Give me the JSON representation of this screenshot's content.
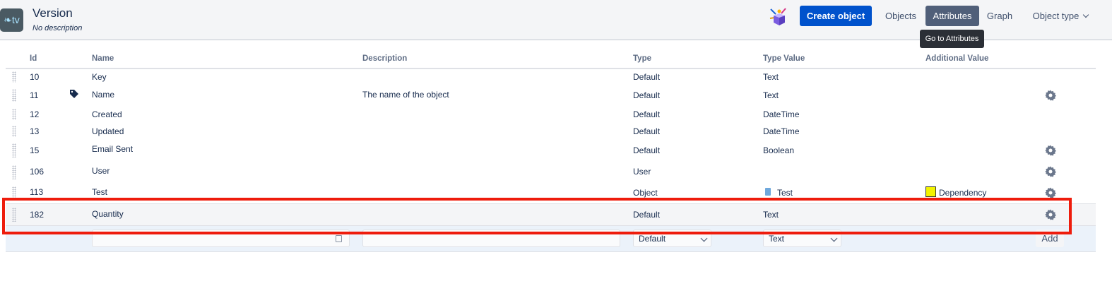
{
  "header": {
    "app_logo_text": "❧tv",
    "title": "Version",
    "subtitle": "No description",
    "create_button": "Create object",
    "nav": {
      "objects": "Objects",
      "attributes": "Attributes",
      "graph": "Graph",
      "object_type": "Object type"
    },
    "tooltip": "Go to Attributes"
  },
  "table": {
    "columns": [
      "Id",
      "Name",
      "Description",
      "Type",
      "Type Value",
      "Additional Value"
    ],
    "rows": [
      {
        "id": "10",
        "name": "Key",
        "description": "",
        "type": "Default",
        "type_value": "Text",
        "additional": "",
        "label_icon": false,
        "settings": false
      },
      {
        "id": "11",
        "name": "Name",
        "description": "The name of the object",
        "type": "Default",
        "type_value": "Text",
        "additional": "",
        "label_icon": true,
        "settings": true
      },
      {
        "id": "12",
        "name": "Created",
        "description": "",
        "type": "Default",
        "type_value": "DateTime",
        "additional": "",
        "label_icon": false,
        "settings": false
      },
      {
        "id": "13",
        "name": "Updated",
        "description": "",
        "type": "Default",
        "type_value": "DateTime",
        "additional": "",
        "label_icon": false,
        "settings": false
      },
      {
        "id": "15",
        "name": "Email Sent",
        "description": "",
        "type": "Default",
        "type_value": "Boolean",
        "additional": "",
        "label_icon": false,
        "settings": true
      },
      {
        "id": "106",
        "name": "User",
        "description": "",
        "type": "User",
        "type_value": "",
        "additional": "",
        "label_icon": false,
        "settings": true
      },
      {
        "id": "113",
        "name": "Test",
        "description": "",
        "type": "Object",
        "type_value": "Test",
        "additional": "Dependency",
        "label_icon": false,
        "settings": true
      },
      {
        "id": "182",
        "name": "Quantity",
        "description": "",
        "type": "Default",
        "type_value": "Text",
        "additional": "",
        "label_icon": false,
        "settings": true
      }
    ],
    "new_row": {
      "name_value": "",
      "description_value": "",
      "type_selected": "Default",
      "type_value_selected": "Text",
      "add_label": "Add"
    }
  },
  "colors": {
    "primary": "#0052cc",
    "active_nav": "#505f79",
    "highlight": "#ee1c0c",
    "dependency_swatch": "#f3f300"
  }
}
